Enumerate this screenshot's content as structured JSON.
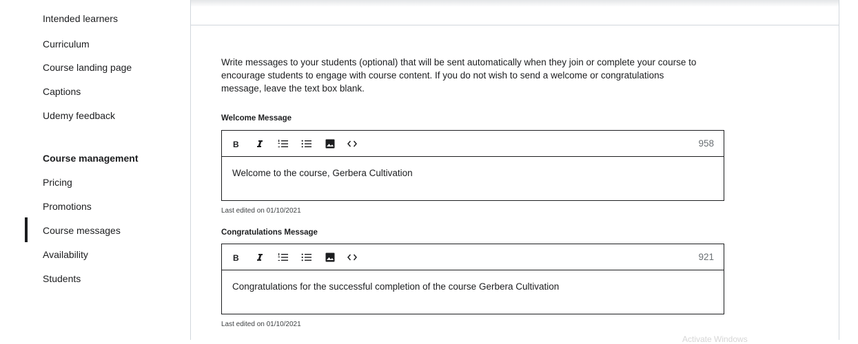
{
  "sidebar": {
    "items_top": [
      {
        "label": "Intended learners"
      },
      {
        "label": "Curriculum"
      },
      {
        "label": "Course landing page"
      },
      {
        "label": "Captions"
      },
      {
        "label": "Udemy feedback"
      }
    ],
    "section_heading": "Course management",
    "items_bottom": [
      {
        "label": "Pricing"
      },
      {
        "label": "Promotions"
      },
      {
        "label": "Course messages",
        "active": true
      },
      {
        "label": "Availability"
      },
      {
        "label": "Students"
      }
    ]
  },
  "main": {
    "intro": "Write messages to your students (optional) that will be sent automatically when they join or complete your course to encourage students to engage with course content. If you do not wish to send a welcome or congratulations message, leave the text box blank.",
    "welcome": {
      "label": "Welcome Message",
      "counter": "958",
      "text": "Welcome to the course, Gerbera Cultivation",
      "last_edited": "Last edited on 01/10/2021"
    },
    "congrats": {
      "label": "Congratulations Message",
      "counter": "921",
      "text": "Congratulations for the successful completion of the course Gerbera Cultivation",
      "last_edited": "Last edited on 01/10/2021"
    },
    "toolbar_icons": [
      "bold-icon",
      "italic-icon",
      "numbered-list-icon",
      "bulleted-list-icon",
      "image-icon",
      "code-icon"
    ]
  },
  "watermark": "Activate Windows"
}
